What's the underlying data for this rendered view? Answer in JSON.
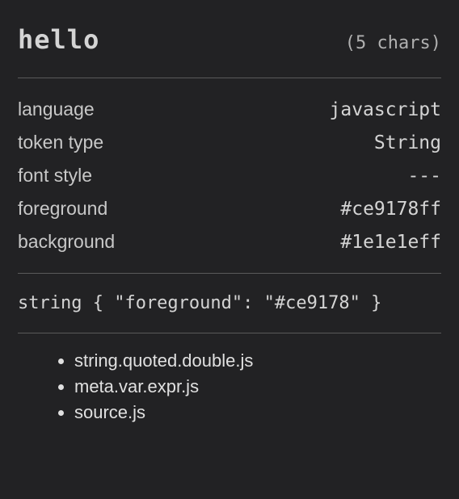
{
  "header": {
    "token": "hello",
    "char_count": "(5 chars)"
  },
  "properties": {
    "language": {
      "label": "language",
      "value": "javascript"
    },
    "token_type": {
      "label": "token type",
      "value": "String"
    },
    "font_style": {
      "label": "font style",
      "value": "---"
    },
    "foreground": {
      "label": "foreground",
      "value": "#ce9178ff"
    },
    "background": {
      "label": "background",
      "value": "#1e1e1eff"
    }
  },
  "rule": "string { \"foreground\": \"#ce9178\" }",
  "scopes": [
    "string.quoted.double.js",
    "meta.var.expr.js",
    "source.js"
  ]
}
